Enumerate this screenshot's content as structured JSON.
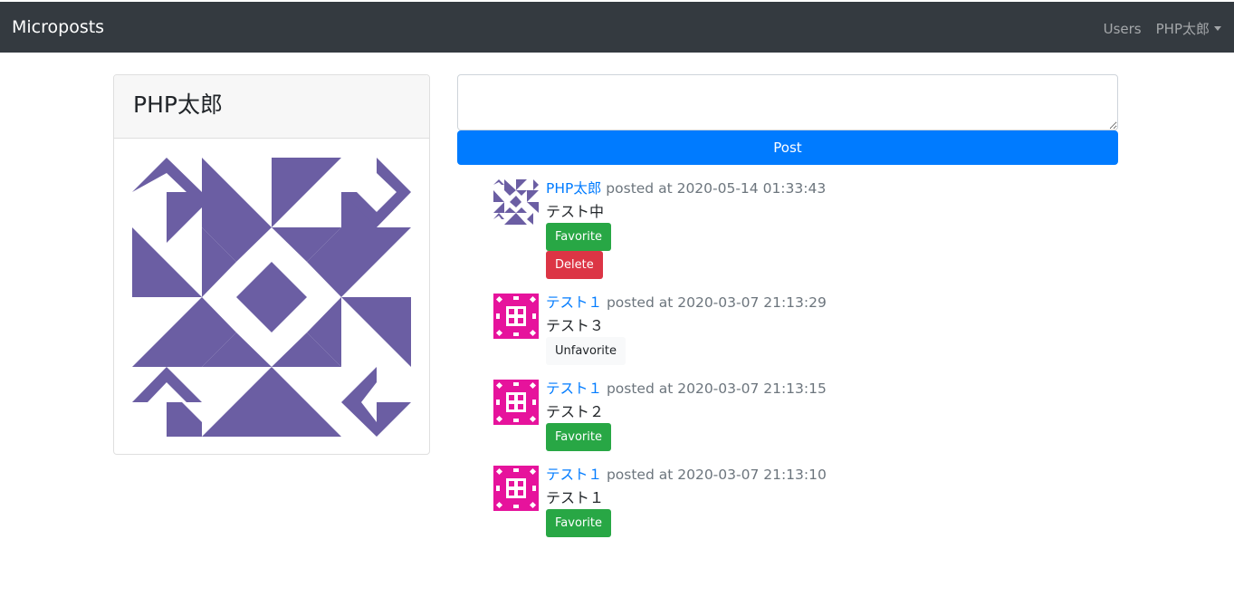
{
  "navbar": {
    "brand": "Microposts",
    "users_link": "Users",
    "user_menu": "PHP太郎"
  },
  "profile": {
    "name": "PHP太郎"
  },
  "form": {
    "textarea_value": "",
    "post_label": "Post"
  },
  "microposts": [
    {
      "user": "PHP太郎",
      "posted_at": "posted at 2020-05-14 01:33:43",
      "content": "テスト中",
      "favorite_label": "Favorite",
      "delete_label": "Delete"
    },
    {
      "user": "テスト１",
      "posted_at": "posted at 2020-03-07 21:13:29",
      "content": "テスト３",
      "unfavorite_label": "Unfavorite"
    },
    {
      "user": "テスト１",
      "posted_at": "posted at 2020-03-07 21:13:15",
      "content": "テスト２",
      "favorite_label": "Favorite"
    },
    {
      "user": "テスト１",
      "posted_at": "posted at 2020-03-07 21:13:10",
      "content": "テスト１",
      "favorite_label": "Favorite"
    }
  ],
  "colors": {
    "navbar_bg": "#343a40",
    "primary": "#007bff",
    "success": "#28a745",
    "danger": "#dc3545",
    "avatar_purple": "#6b5ea3",
    "avatar_pink": "#e6139c"
  },
  "icons": {
    "profile_avatar": "identicon-avatar",
    "user_avatar": "identicon-avatar"
  }
}
